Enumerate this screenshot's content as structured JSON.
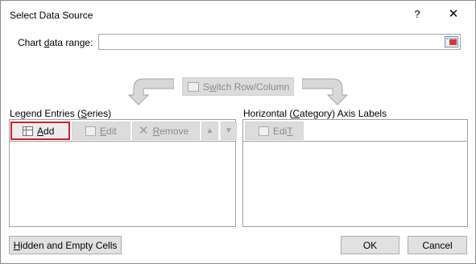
{
  "dialog": {
    "title": "Select Data Source",
    "help": "?",
    "close": "✕"
  },
  "range": {
    "label_pre": "Chart ",
    "label_key": "d",
    "label_post": "ata range:",
    "value": ""
  },
  "switch_button": {
    "label_pre": "S",
    "label_key": "w",
    "label_post": "itch Row/Column",
    "enabled": false
  },
  "legend": {
    "label_pre": "Legend Entries (",
    "label_key": "S",
    "label_post": "eries)",
    "add": {
      "key": "A",
      "rest": "dd"
    },
    "edit": {
      "key": "E",
      "rest": "dit"
    },
    "remove": {
      "key": "R",
      "rest": "emove"
    },
    "up_glyph": "▲",
    "down_glyph": "▼",
    "items": []
  },
  "axis": {
    "label_pre": "Horizontal (",
    "label_key": "C",
    "label_post": "ategory) Axis Labels",
    "edit": {
      "key": "T",
      "pre": "Edi"
    },
    "items": []
  },
  "footer": {
    "hidden_key": "H",
    "hidden_rest": "idden and Empty Cells",
    "ok": "OK",
    "cancel": "Cancel"
  },
  "colors": {
    "focus_border": "#c4262e",
    "disabled_text": "#8a8a8a",
    "arrow_gray": "#a3a3a3"
  }
}
